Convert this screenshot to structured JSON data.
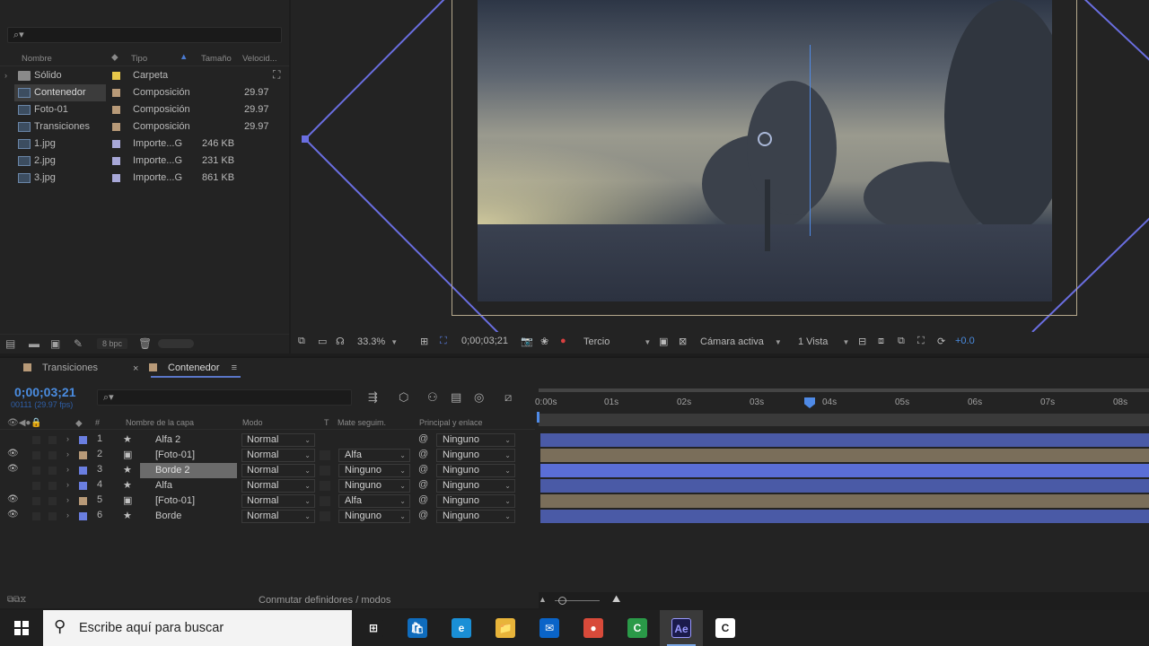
{
  "project": {
    "search_placeholder": "",
    "columns": {
      "name": "Nombre",
      "type": "Tipo",
      "size": "Tamaño",
      "speed": "Velocid..."
    },
    "items": [
      {
        "name": "Sólido",
        "type": "Carpeta",
        "size": "",
        "fps": "",
        "color": "#e8c84a",
        "kind": "folder"
      },
      {
        "name": "Contenedor",
        "type": "Composición",
        "size": "",
        "fps": "29.97",
        "color": "#b89a78",
        "kind": "comp"
      },
      {
        "name": "Foto-01",
        "type": "Composición",
        "size": "",
        "fps": "29.97",
        "color": "#b89a78",
        "kind": "comp"
      },
      {
        "name": "Transiciones",
        "type": "Composición",
        "size": "",
        "fps": "29.97",
        "color": "#b89a78",
        "kind": "comp"
      },
      {
        "name": "1.jpg",
        "type": "Importe...G",
        "size": "246 KB",
        "fps": "",
        "color": "#a8a8d8",
        "kind": "image"
      },
      {
        "name": "2.jpg",
        "type": "Importe...G",
        "size": "231 KB",
        "fps": "",
        "color": "#a8a8d8",
        "kind": "image"
      },
      {
        "name": "3.jpg",
        "type": "Importe...G",
        "size": "861 KB",
        "fps": "",
        "color": "#a8a8d8",
        "kind": "image"
      }
    ],
    "bpc": "8 bpc"
  },
  "viewer": {
    "zoom": "33.3%",
    "timecode": "0;00;03;21",
    "resolution": "Tercio",
    "camera": "Cámara activa",
    "views": "1 Vista",
    "exposure": "+0.0"
  },
  "timeline": {
    "tabs": [
      {
        "label": "Transiciones",
        "color": "#b89a78"
      },
      {
        "label": "Contenedor",
        "color": "#b89a78"
      }
    ],
    "timecode": "0;00;03;21",
    "fps_info": "00111 (29.97 fps)",
    "ruler": [
      "0:00s",
      "01s",
      "02s",
      "03s",
      "04s",
      "05s",
      "06s",
      "07s",
      "08s"
    ],
    "columns": {
      "layer_name": "Nombre de la capa",
      "mode": "Modo",
      "t": "T",
      "matte": "Mate seguim.",
      "parent": "Principal y enlace"
    },
    "layers": [
      {
        "num": "1",
        "name": "Alfa 2",
        "mode": "Normal",
        "matte": "",
        "parent": "Ninguno",
        "color": "#6a7ee0",
        "type": "star",
        "bar": "#4a5aa6",
        "eye": false
      },
      {
        "num": "2",
        "name": "[Foto-01]",
        "mode": "Normal",
        "matte": "Alfa",
        "parent": "Ninguno",
        "color": "#b89a78",
        "type": "comp",
        "bar": "#7a6e5a",
        "eye": true
      },
      {
        "num": "3",
        "name": "Borde 2",
        "mode": "Normal",
        "matte": "Ninguno",
        "parent": "Ninguno",
        "color": "#6a7ee0",
        "type": "star",
        "bar": "#5a6ed6",
        "eye": true,
        "selected": true
      },
      {
        "num": "4",
        "name": "Alfa",
        "mode": "Normal",
        "matte": "Ninguno",
        "parent": "Ninguno",
        "color": "#6a7ee0",
        "type": "star",
        "bar": "#4a5aa6",
        "eye": false
      },
      {
        "num": "5",
        "name": "[Foto-01]",
        "mode": "Normal",
        "matte": "Alfa",
        "parent": "Ninguno",
        "color": "#b89a78",
        "type": "comp",
        "bar": "#7a6e5a",
        "eye": true
      },
      {
        "num": "6",
        "name": "Borde",
        "mode": "Normal",
        "matte": "Ninguno",
        "parent": "Ninguno",
        "color": "#6a7ee0",
        "type": "star",
        "bar": "#4a5aa6",
        "eye": true
      }
    ],
    "footer": "Conmutar definidores / modos"
  },
  "taskbar": {
    "search_text": "Escribe aquí para buscar",
    "apps": [
      {
        "name": "task-view-icon",
        "label": "⊞",
        "color": "#1f1f1f"
      },
      {
        "name": "store-icon",
        "label": "🛍",
        "color": "#0f6cbd"
      },
      {
        "name": "edge-icon",
        "label": "e",
        "color": "#1a8fd6"
      },
      {
        "name": "file-explorer-icon",
        "label": "📁",
        "color": "#e8b43a"
      },
      {
        "name": "mail-icon",
        "label": "✉",
        "color": "#0a64c8"
      },
      {
        "name": "chrome-icon",
        "label": "●",
        "color": "#d84a3a"
      },
      {
        "name": "camtasia-icon",
        "label": "C",
        "color": "#2a9a48"
      },
      {
        "name": "after-effects-icon",
        "label": "Ae",
        "color": "#1b1b4b"
      },
      {
        "name": "camtasia-recorder-icon",
        "label": "C",
        "color": "#1f1f1f"
      }
    ]
  }
}
